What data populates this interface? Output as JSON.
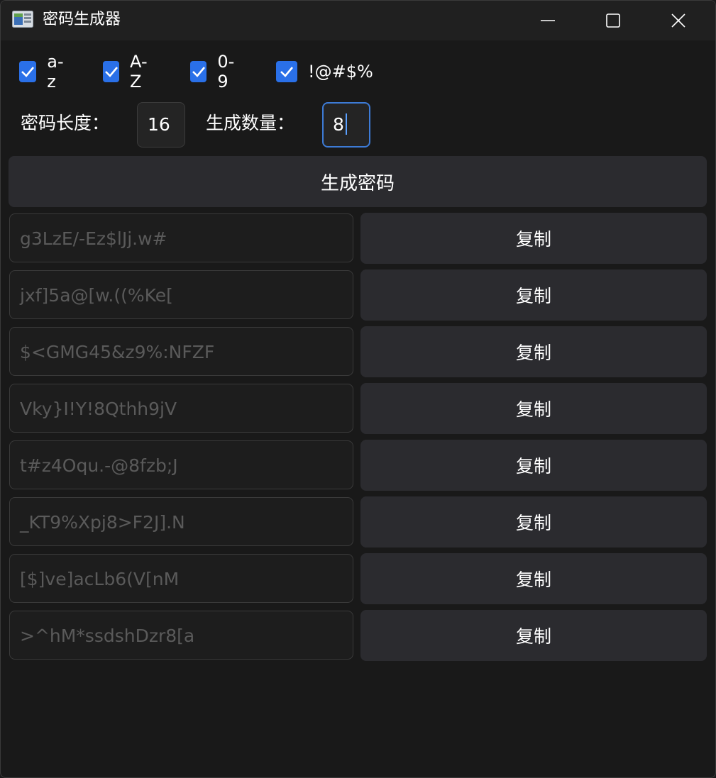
{
  "window": {
    "title": "密码生成器",
    "icon": "app-window-icon",
    "controls": [
      "minimize-icon",
      "maximize-icon",
      "close-icon"
    ]
  },
  "charsets": [
    {
      "label": "a-z",
      "checked": true
    },
    {
      "label": "A-Z",
      "checked": true
    },
    {
      "label": "0-9",
      "checked": true
    },
    {
      "label": "!@#$%",
      "checked": true
    }
  ],
  "length": {
    "label": "密码长度：",
    "value": "16"
  },
  "count": {
    "label": "生成数量：",
    "value": "8"
  },
  "generate_button": "生成密码",
  "passwords": [
    {
      "value": "g3LzE/-Ez$lJj.w#",
      "copy_label": "复制"
    },
    {
      "value": "jxf]5a@[w.((%Ke[",
      "copy_label": "复制"
    },
    {
      "value": "$<GMG45&z9%:NFZF",
      "copy_label": "复制"
    },
    {
      "value": "Vky}I!Y!8Qthh9jV",
      "copy_label": "复制"
    },
    {
      "value": "t#z4Oqu.-@8fzb;J",
      "copy_label": "复制"
    },
    {
      "value": "_KT9%Xpj8>F2J].N",
      "copy_label": "复制"
    },
    {
      "value": "[$]ve]acLb6(V[nM",
      "copy_label": "复制"
    },
    {
      "value": ">^hM*ssdshDzr8[a",
      "copy_label": "复制"
    }
  ],
  "colors": {
    "accent": "#2a70e8",
    "focus": "#3d7bd6",
    "background": "#191919",
    "button": "#2b2b2f"
  }
}
